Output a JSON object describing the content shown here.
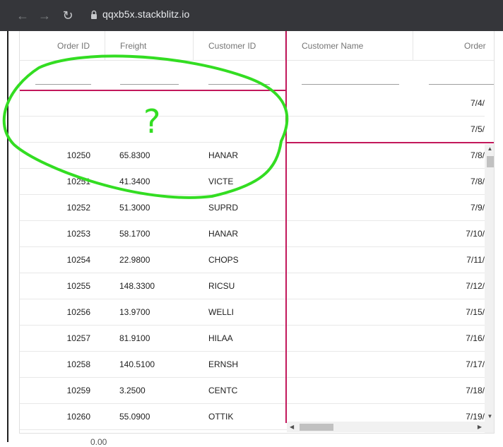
{
  "browser": {
    "url": "qqxb5x.stackblitz.io",
    "back_icon": "arrow-left-icon",
    "forward_icon": "arrow-right-icon",
    "reload_icon": "reload-icon",
    "lock_icon": "lock-icon"
  },
  "grid": {
    "headers": [
      "Order ID",
      "Freight",
      "Customer ID",
      "Customer Name",
      "Order"
    ],
    "partial_dates": [
      "7/4/",
      "7/5/"
    ],
    "rows": [
      {
        "order_id": "10250",
        "freight": "65.8300",
        "customer_id": "HANAR",
        "date": "7/8/"
      },
      {
        "order_id": "10251",
        "freight": "41.3400",
        "customer_id": "VICTE",
        "date": "7/8/"
      },
      {
        "order_id": "10252",
        "freight": "51.3000",
        "customer_id": "SUPRD",
        "date": "7/9/"
      },
      {
        "order_id": "10253",
        "freight": "58.1700",
        "customer_id": "HANAR",
        "date": "7/10/"
      },
      {
        "order_id": "10254",
        "freight": "22.9800",
        "customer_id": "CHOPS",
        "date": "7/11/"
      },
      {
        "order_id": "10255",
        "freight": "148.3300",
        "customer_id": "RICSU",
        "date": "7/12/"
      },
      {
        "order_id": "10256",
        "freight": "13.9700",
        "customer_id": "WELLI",
        "date": "7/15/"
      },
      {
        "order_id": "10257",
        "freight": "81.9100",
        "customer_id": "HILAA",
        "date": "7/16/"
      },
      {
        "order_id": "10258",
        "freight": "140.5100",
        "customer_id": "ERNSH",
        "date": "7/17/"
      },
      {
        "order_id": "10259",
        "freight": "3.2500",
        "customer_id": "CENTC",
        "date": "7/18/"
      },
      {
        "order_id": "10260",
        "freight": "55.0900",
        "customer_id": "OTTIK",
        "date": "7/19/"
      }
    ],
    "accent_color": "#c2185b"
  },
  "annotation": {
    "symbol": "?",
    "color": "#33dd22"
  },
  "footer_cutoff": "0.00"
}
